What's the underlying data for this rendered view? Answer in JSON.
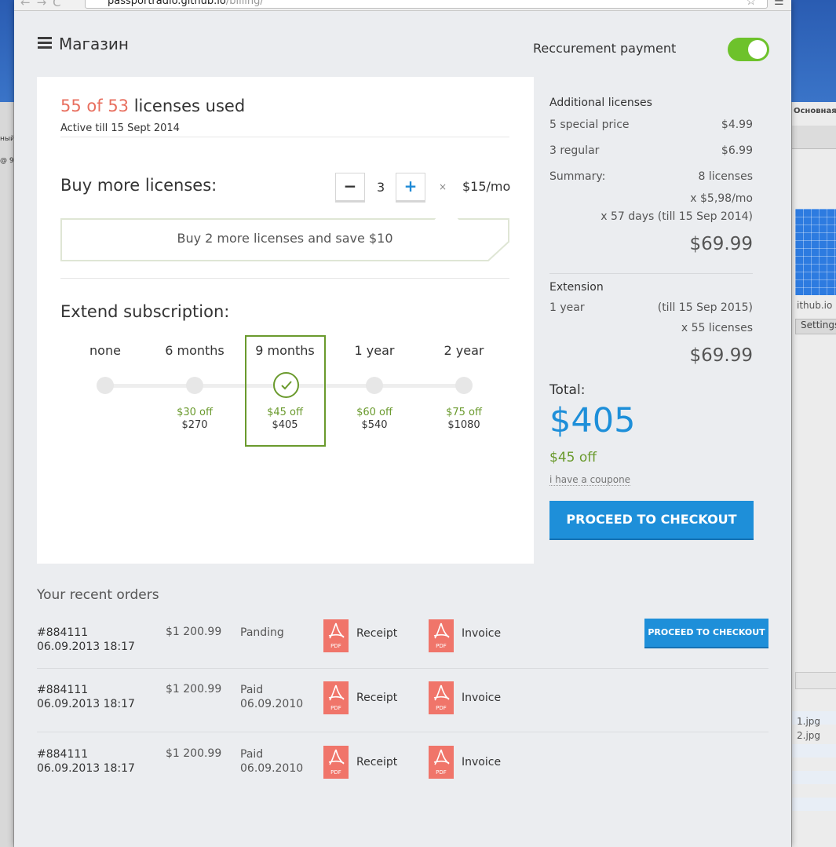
{
  "browser": {
    "url_host": "passportradio.github.io",
    "url_path": "/billing/"
  },
  "header": {
    "title": "Магазин",
    "recurrent_label": "Reccurement payment",
    "recurrent_on": true
  },
  "licenses": {
    "used": "55 of 53",
    "used_suffix": " licenses used",
    "active_till": "Active till 15 Sept 2014",
    "buy_title": "Buy more licenses:",
    "minus": "−",
    "plus": "+",
    "quantity": "3",
    "times": "×",
    "price": "$15/mo",
    "promo": "Buy 2 more licenses and save $10"
  },
  "extend": {
    "title": "Extend subscription:",
    "options": [
      {
        "label": "none",
        "off": "",
        "price": ""
      },
      {
        "label": "6 months",
        "off": "$30 off",
        "price": "$270"
      },
      {
        "label": "9 months",
        "off": "$45 off",
        "price": "$405",
        "selected": true
      },
      {
        "label": "1 year",
        "off": "$60 off",
        "price": "$540"
      },
      {
        "label": "2 year",
        "off": "$75 off",
        "price": "$1080"
      }
    ]
  },
  "summary": {
    "additional_title": "Additional licenses",
    "special_label": "5 special price",
    "special_price": "$4.99",
    "regular_label": "3 regular",
    "regular_price": "$6.99",
    "summary_label": "Summary:",
    "summary_count": "8 licenses",
    "summary_rate": "x $5,98/mo",
    "summary_days": "x 57 days (till 15 Sep 2014)",
    "summary_total": "$69.99",
    "extension_title": "Extension",
    "extension_period": "1 year",
    "extension_till": "(till 15 Sep 2015)",
    "extension_count": "x 55 licenses",
    "extension_total": "$69.99",
    "total_label": "Total:",
    "total": "$405",
    "total_off": "$45 off",
    "coupon": "i have a coupone",
    "checkout": "PROCEED TO CHECKOUT"
  },
  "orders": {
    "title": "Your recent orders",
    "receipt_label": "Receipt",
    "invoice_label": "Invoice",
    "pdf_label": "PDF",
    "checkout_small": "PROCEED TO CHECKOUT",
    "rows": [
      {
        "id": "#884111",
        "date": "06.09.2013 18:17",
        "amount": "$1 200.99",
        "status": "Panding",
        "status_date": ""
      },
      {
        "id": "#884111",
        "date": "06.09.2013 18:17",
        "amount": "$1 200.99",
        "status": "Paid",
        "status_date": "06.09.2010"
      },
      {
        "id": "#884111",
        "date": "06.09.2013 18:17",
        "amount": "$1 200.99",
        "status": "Paid",
        "status_date": "06.09.2010"
      }
    ]
  },
  "background": {
    "right_tab": "Основная",
    "right_site": "ithub.io",
    "right_settings": "Settings",
    "file1": "1.jpg",
    "file2": "2.jpg",
    "left_1": "ный",
    "left_2": "@ 9"
  },
  "colors": {
    "accent_blue": "#1e8fd9",
    "green": "#6a9a2d",
    "red": "#e86f5f",
    "toggle_green": "#6dc22b",
    "pdf_red": "#f0756a"
  }
}
